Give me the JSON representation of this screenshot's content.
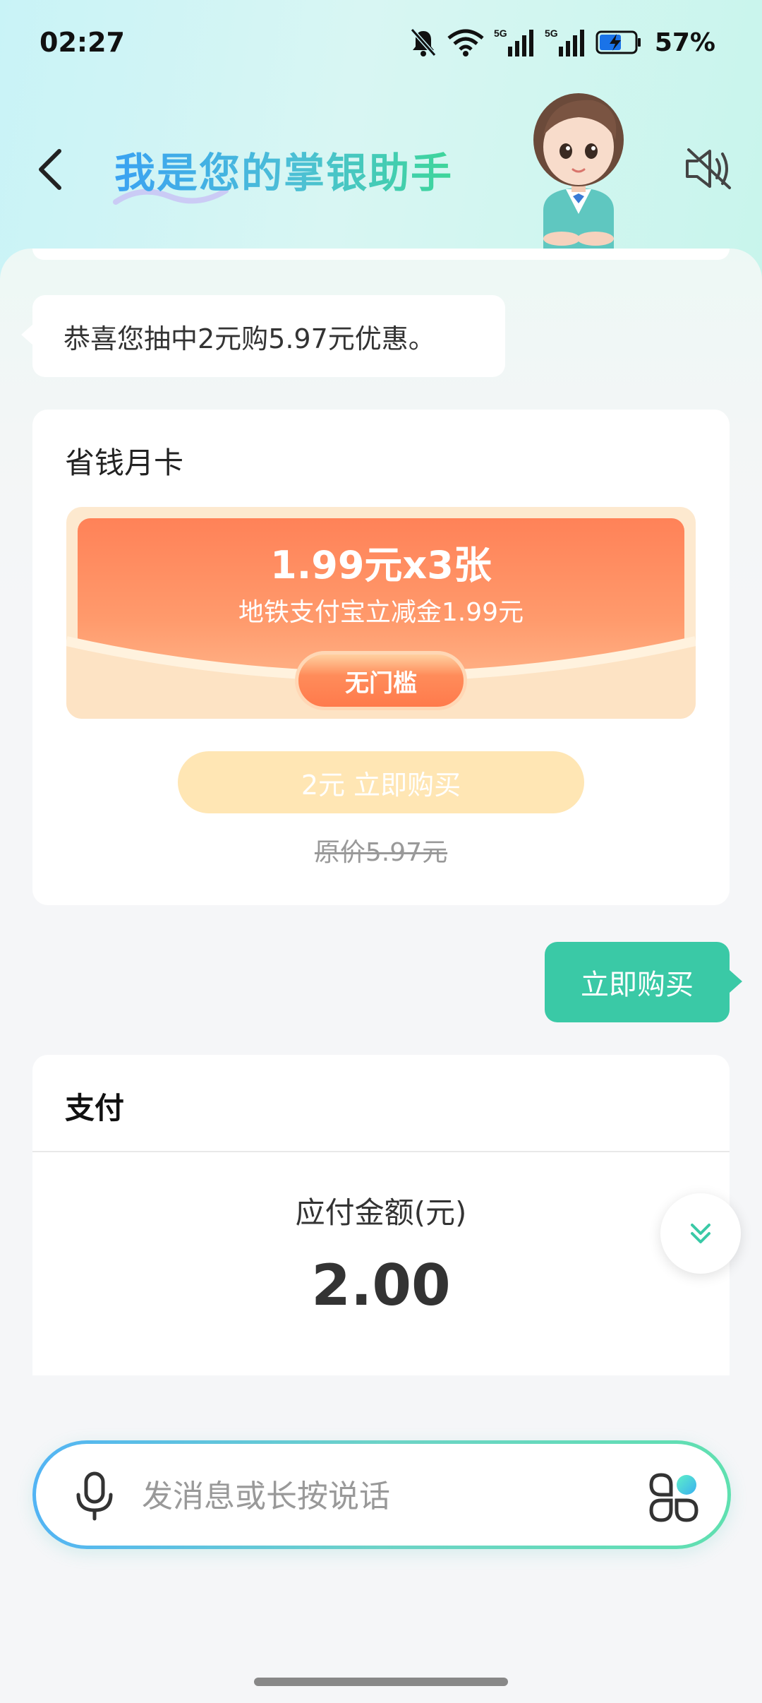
{
  "status_bar": {
    "time": "02:27",
    "battery": "57%",
    "icons": [
      "mute-icon",
      "wifi-icon",
      "signal-5g-icon",
      "signal-5g-icon",
      "battery-charging-icon"
    ]
  },
  "header": {
    "title": "我是您的掌银助手",
    "back_icon": "chevron-left-icon",
    "sound_icon": "speaker-muted-icon"
  },
  "messages": {
    "bot_text": "恭喜您抽中2元购5.97元优惠。",
    "user_text": "立即购买"
  },
  "offer_card": {
    "title": "省钱月卡",
    "coupon_amount": "1.99元x3张",
    "coupon_desc": "地铁支付宝立减金1.99元",
    "coupon_tag": "无门槛",
    "buy_button": "2元 立即购买",
    "original_price": "原价5.97元"
  },
  "payment_card": {
    "title": "支付",
    "amount_label": "应付金额(元)",
    "amount": "2.00"
  },
  "input_bar": {
    "placeholder": "发消息或长按说话"
  },
  "colors": {
    "accent_green": "#3ac9a6",
    "coupon_orange": "#ff8258",
    "buy_button_bg": "#ffe6b4"
  }
}
